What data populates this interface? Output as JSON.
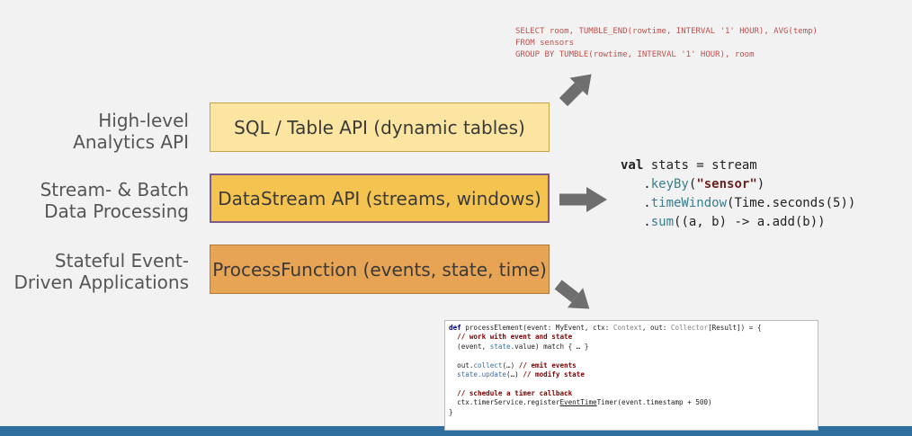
{
  "levels": [
    {
      "label_line1": "High-level",
      "label_line2": "Analytics API",
      "box": "SQL / Table API (dynamic tables)"
    },
    {
      "label_line1": "Stream- & Batch",
      "label_line2": "Data Processing",
      "box": "DataStream API (streams, windows)"
    },
    {
      "label_line1": "Stateful Event-",
      "label_line2": "Driven Applications",
      "box": "ProcessFunction (events, state, time)"
    }
  ],
  "sql_code": {
    "line1": "SELECT room, TUMBLE_END(rowtime, INTERVAL '1' HOUR), AVG(temp)",
    "line2": "FROM sensors",
    "line3": "GROUP BY TUMBLE(rowtime, INTERVAL '1' HOUR), room"
  },
  "scala_code": {
    "kw_val": "val",
    "decl": " stats = stream",
    "dot1": "   .",
    "fn_keyby": "keyBy",
    "paren_open": "(",
    "str_sensor": "\"sensor\"",
    "paren_close": ")",
    "dot2": "   .",
    "fn_timewindow": "timeWindow",
    "timewindow_args": "(Time.seconds(5))",
    "dot3": "   .",
    "fn_sum": "sum",
    "sum_args": "((a, b) -> a.add(b))"
  },
  "java_code": {
    "kw_def": "def",
    "name": " processElement(event: MyEvent, ctx: ",
    "ty_context": "Context",
    "mid": ", out: ",
    "ty_collector": "Collector",
    "tail": "[Result]) = {",
    "comment1": "  // work with event and state",
    "l3a": "  (event, ",
    "l3b": "state",
    "l3c": ".value) match { … }",
    "l5a": "  out.",
    "l5b": "collect",
    "l5c": "(…) ",
    "comment2": "// emit events",
    "l6a": "  state.",
    "l6b": "update",
    "l6c": "(…) ",
    "comment3": "// modify state",
    "comment4": "  // schedule a timer callback",
    "l9a": "  ctx.timerService.register",
    "l9b": "EventTime",
    "l9c": "Timer(event.timestamp + 500)",
    "close": "}"
  },
  "colors": {
    "sql_box": "#fce5a0",
    "datastream_box": "#f4c350",
    "processfunction_box": "#e6a454",
    "arrow": "#6e6e6e",
    "sql_text": "#c0504d",
    "footer": "#2f6f9f"
  }
}
